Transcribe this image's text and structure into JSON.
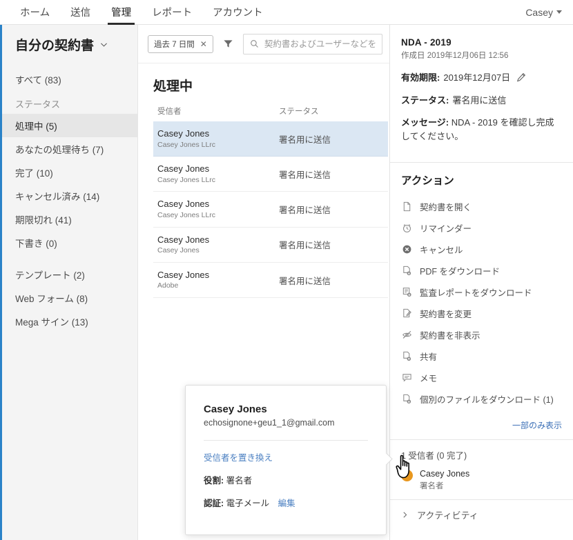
{
  "topnav": {
    "tabs": [
      {
        "label": "ホーム",
        "active": false
      },
      {
        "label": "送信",
        "active": false
      },
      {
        "label": "管理",
        "active": true
      },
      {
        "label": "レポート",
        "active": false
      },
      {
        "label": "アカウント",
        "active": false
      }
    ],
    "user_label": "Casey",
    "user_caret_icon": "chevron-down-icon"
  },
  "sidebar": {
    "title": "自分の契約書",
    "title_caret_icon": "chevron-down-icon",
    "all_item": "すべて (83)",
    "status_group_label": "ステータス",
    "status_items": [
      {
        "label": "処理中 (5)",
        "selected": true
      },
      {
        "label": "あなたの処理待ち (7)",
        "selected": false
      },
      {
        "label": "完了 (10)",
        "selected": false
      },
      {
        "label": "キャンセル済み (14)",
        "selected": false
      },
      {
        "label": "期限切れ (41)",
        "selected": false
      },
      {
        "label": "下書き (0)",
        "selected": false
      }
    ],
    "other_items": [
      {
        "label": "テンプレート (2)"
      },
      {
        "label": "Web フォーム (8)"
      },
      {
        "label": "Mega サイン (13)"
      }
    ]
  },
  "toolbar": {
    "date_chip": "過去 7 日間",
    "date_chip_close_icon": "close-icon",
    "filter_icon": "funnel-icon",
    "search_icon": "search-icon",
    "search_placeholder": "契約書およびユーザーなどを検索",
    "search_value": ""
  },
  "main": {
    "section_title": "処理中",
    "columns": [
      "受信者",
      "ステータス"
    ],
    "rows": [
      {
        "name": "Casey Jones",
        "sub": "Casey Jones LLrc",
        "status": "署名用に送信",
        "selected": true
      },
      {
        "name": "Casey Jones",
        "sub": "Casey Jones LLrc",
        "status": "署名用に送信",
        "selected": false
      },
      {
        "name": "Casey Jones",
        "sub": "Casey Jones LLrc",
        "status": "署名用に送信",
        "selected": false
      },
      {
        "name": "Casey Jones",
        "sub": "Casey Jones",
        "status": "署名用に送信",
        "selected": false
      },
      {
        "name": "Casey Jones",
        "sub": "Adobe",
        "status": "署名用に送信",
        "selected": false
      }
    ]
  },
  "details": {
    "title": "NDA - 2019",
    "created": "作成日 2019年12月06日 12:56",
    "expiry_label": "有効期限:",
    "expiry_value": "2019年12月07日",
    "expiry_edit_icon": "pencil-icon",
    "status_label": "ステータス:",
    "status_value": "署名用に送信",
    "message_label": "メッセージ:",
    "message_value": "NDA - 2019 を確認し完成してください。"
  },
  "actions": {
    "heading": "アクション",
    "items": [
      {
        "label": "契約書を開く",
        "icon": "document-icon"
      },
      {
        "label": "リマインダー",
        "icon": "alarm-clock-icon"
      },
      {
        "label": "キャンセル",
        "icon": "circle-x-icon"
      },
      {
        "label": "PDF をダウンロード",
        "icon": "pdf-download-icon"
      },
      {
        "label": "監査レポートをダウンロード",
        "icon": "audit-report-download-icon"
      },
      {
        "label": "契約書を変更",
        "icon": "document-edit-icon"
      },
      {
        "label": "契約書を非表示",
        "icon": "eye-off-icon"
      },
      {
        "label": "共有",
        "icon": "share-document-icon"
      },
      {
        "label": "メモ",
        "icon": "note-icon"
      },
      {
        "label": "個別のファイルをダウンロード (1)",
        "icon": "file-download-icon"
      }
    ],
    "show_less_label": "一部のみ表示"
  },
  "recipients": {
    "count_label": "1 受信者 (0 完了)",
    "items": [
      {
        "name": "Casey Jones",
        "role": "署名者",
        "avatar_color": "#e8971e"
      }
    ]
  },
  "activity": {
    "label": "アクティビティ",
    "chevron_icon": "chevron-right-icon"
  },
  "popup": {
    "name": "Casey Jones",
    "email": "echosignone+geu1_1@gmail.com",
    "replace_link": "受信者を置き換え",
    "role_label": "役割:",
    "role_value": "署名者",
    "auth_label": "認証:",
    "auth_value": "電子メール",
    "auth_edit_link": "編集"
  },
  "cursor": {
    "icon": "hand-pointer-cursor"
  },
  "colors": {
    "accent_blue": "#2a82c8",
    "link_blue": "#4a7fc1",
    "row_selected": "#dbe7f3",
    "sidebar_bg": "#f4f4f4",
    "avatar_orange": "#e8971e"
  }
}
